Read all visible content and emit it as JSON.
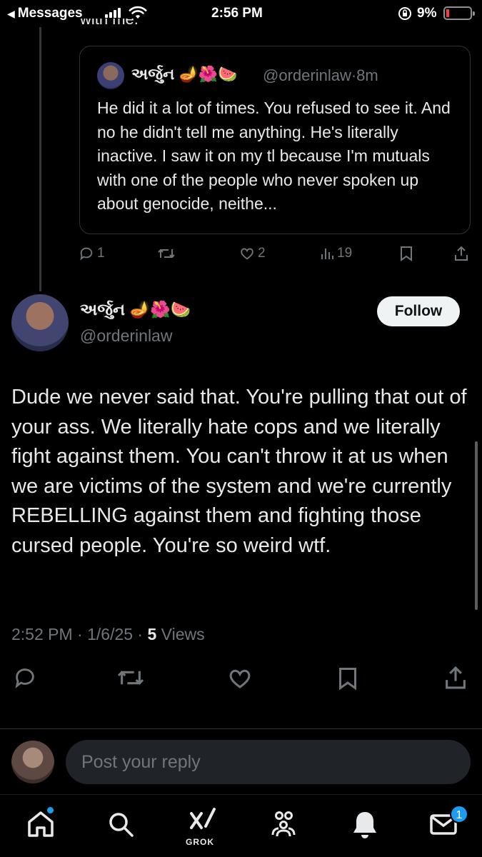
{
  "status_bar": {
    "back_label": "Messages",
    "time": "2:56 PM",
    "battery": "9%"
  },
  "thread": {
    "cut_text": "with me."
  },
  "quoted_reply": {
    "name": "અર્જુન 🪔🌺🍉",
    "handle": "@orderinlaw",
    "time_sep": "·",
    "time": "8m",
    "text": "He did it a lot of times. You refused to see it. And no he didn't tell me anything. He's literally inactive. I saw it on my tl because I'm mutuals with one of the people who never spoken up about genocide, neithe...",
    "replies": "1",
    "likes": "2",
    "views": "19"
  },
  "tweet": {
    "name": "અર્જુન 🪔🌺🍉",
    "handle": "@orderinlaw",
    "follow_label": "Follow",
    "text": "Dude we never said that. You're pulling that out of your ass. We literally hate cops and we literally fight against them. You can't throw it at us when we are victims of the system and we're currently REBELLING against them and fighting those cursed people. You're so weird wtf.",
    "timestamp": "2:52 PM · 1/6/25 · ",
    "views_count": "5",
    "views_label": " Views"
  },
  "reply": {
    "placeholder": "Post your reply"
  },
  "tab_bar": {
    "grok_label": "GROK",
    "messages_badge": "1"
  },
  "colors": {
    "background": "#000000",
    "text": "#e7e9ea",
    "secondary": "#71767b",
    "accent": "#1d9bf0"
  }
}
